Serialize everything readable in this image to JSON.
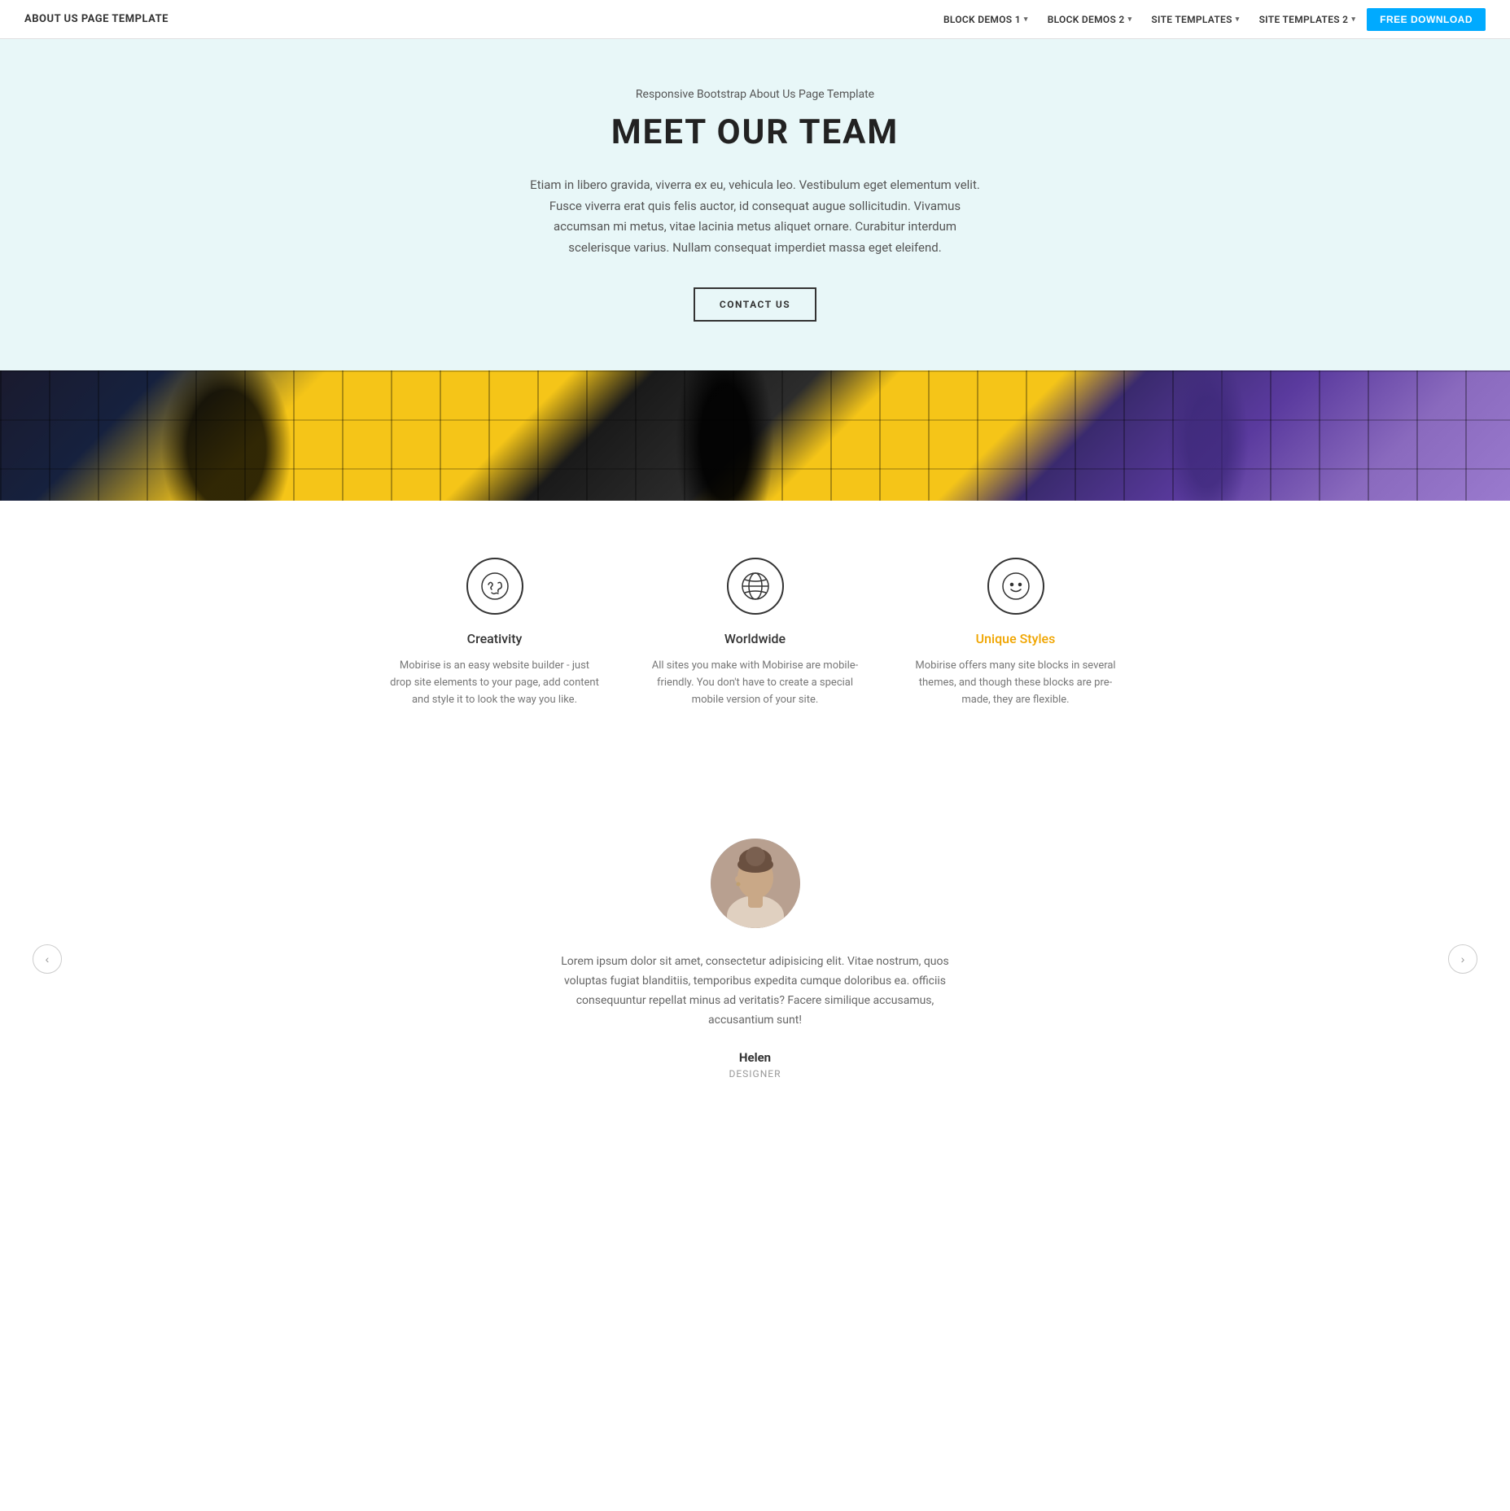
{
  "nav": {
    "brand": "ABOUT US PAGE TEMPLATE",
    "links": [
      {
        "label": "BLOCK DEMOS 1",
        "hasDropdown": true
      },
      {
        "label": "BLOCK DEMOS 2",
        "hasDropdown": true
      },
      {
        "label": "SITE TEMPLATES",
        "hasDropdown": true
      },
      {
        "label": "SITE TEMPLATES 2",
        "hasDropdown": true
      }
    ],
    "cta": "FREE DOWNLOAD"
  },
  "hero": {
    "subtitle": "Responsive Bootstrap About Us Page Template",
    "title": "MEET OUR TEAM",
    "description": "Etiam in libero gravida, viverra ex eu, vehicula leo. Vestibulum eget elementum velit. Fusce viverra erat quis felis auctor, id consequat augue sollicitudin. Vivamus accumsan mi metus, vitae lacinia metus aliquet ornare. Curabitur interdum scelerisque varius. Nullam consequat imperdiet massa eget eleifend.",
    "cta": "CONTACT US"
  },
  "features": {
    "items": [
      {
        "icon": "✦",
        "iconType": "creativity",
        "title": "Creativity",
        "titleAccent": false,
        "description": "Mobirise is an easy website builder - just drop site elements to your page, add content and style it to look the way you like."
      },
      {
        "icon": "🌐",
        "iconType": "worldwide",
        "title": "Worldwide",
        "titleAccent": false,
        "description": "All sites you make with Mobirise are mobile-friendly. You don't have to create a special mobile version of your site."
      },
      {
        "icon": "☺",
        "iconType": "unique",
        "title": "Unique Styles",
        "titleAccent": true,
        "description": "Mobirise offers many site blocks in several themes, and though these blocks are pre-made, they are flexible."
      }
    ]
  },
  "testimonial": {
    "quote": "Lorem ipsum dolor sit amet, consectetur adipisicing elit. Vitae nostrum, quos voluptas fugiat blanditiis, temporibus expedita cumque doloribus ea. officiis consequuntur repellat minus ad veritatis? Facere similique accusamus, accusantium sunt!",
    "name": "Helen",
    "role": "DESIGNER",
    "prevArrow": "‹",
    "nextArrow": "›"
  },
  "colors": {
    "accent": "#00aaff",
    "uniqueStylesColor": "#f0a500",
    "heroBg": "#e8f7f8"
  }
}
